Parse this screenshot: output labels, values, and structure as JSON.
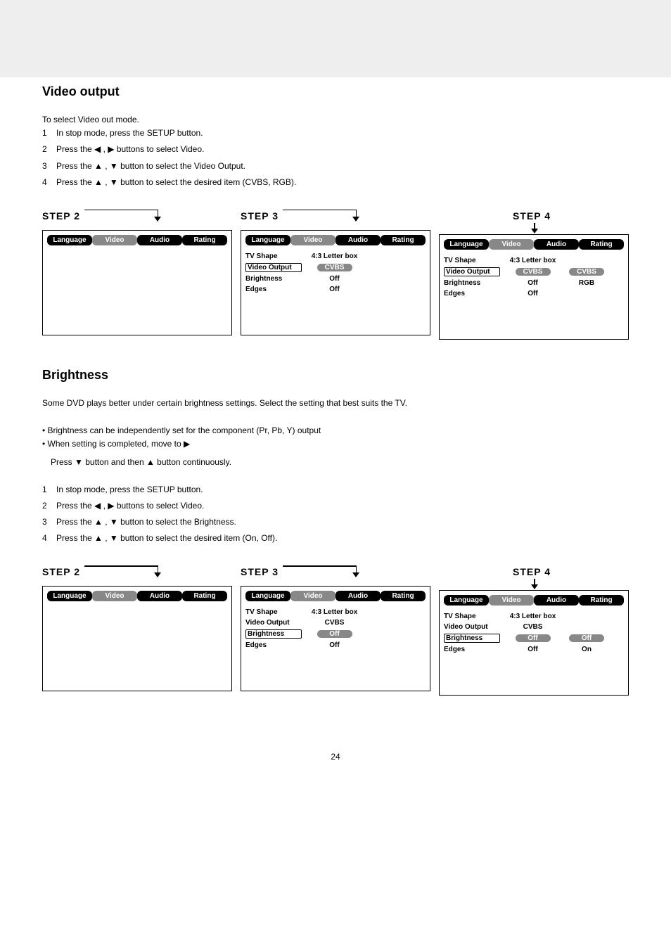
{
  "sectionA": {
    "heading": "Video output",
    "intro": "To select Video out mode.",
    "steps": [
      "In stop mode, press the SETUP button.",
      "Press the ◀ , ▶ buttons to select Video.",
      "Press the ▲ , ▼ button to select the Video Output.",
      "Press the ▲ , ▼ button to select the desired item (CVBS, RGB)."
    ]
  },
  "sectionB": {
    "heading": "Brightness",
    "intro": "Some DVD plays better under certain brightness settings. Select the setting that best suits the TV.",
    "info1": "Brightness can be independently set for the component (Pr, Pb, Y) output",
    "info2": "When setting is completed, move to ▶",
    "info3": "Press ▼ button and then ▲ button continuously.",
    "steps": [
      "In stop mode, press the SETUP button.",
      "Press the ◀ , ▶ buttons to select Video.",
      "Press the ▲ , ▼ button to select the Brightness.",
      "Press the ▲ , ▼ button to select the desired item (On, Off)."
    ]
  },
  "tabs": {
    "language": "Language",
    "video": "Video",
    "audio": "Audio",
    "rating": "Rating"
  },
  "options": {
    "tvshape": "TV Shape",
    "videoout": "Video Output",
    "brightness": "Brightness",
    "edges": "Edges",
    "val_tvshape": "4:3 Letter box",
    "val_cvbs": "CVBS",
    "val_rgb": "RGB",
    "val_off": "Off",
    "val_on": "On"
  },
  "stepLabels": {
    "s2": "STEP 2",
    "s3": "STEP 3",
    "s4": "STEP 4"
  },
  "footer": "24"
}
